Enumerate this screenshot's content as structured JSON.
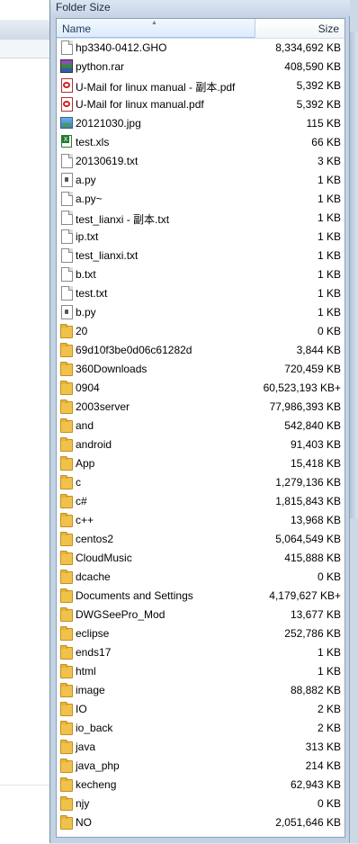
{
  "window": {
    "title": "Folder Size"
  },
  "columns": {
    "name": "Name",
    "size": "Size"
  },
  "items": [
    {
      "icon": "file-icon",
      "name": "hp3340-0412.GHO",
      "size": "8,334,692 KB"
    },
    {
      "icon": "rar-archive-icon",
      "name": "python.rar",
      "size": "408,590 KB"
    },
    {
      "icon": "pdf-icon",
      "name": "U-Mail for linux manual - 副本.pdf",
      "size": "5,392 KB"
    },
    {
      "icon": "pdf-icon",
      "name": "U-Mail for linux manual.pdf",
      "size": "5,392 KB"
    },
    {
      "icon": "image-icon",
      "name": "20121030.jpg",
      "size": "115 KB"
    },
    {
      "icon": "excel-icon",
      "name": "test.xls",
      "size": "66 KB"
    },
    {
      "icon": "file-icon",
      "name": "20130619.txt",
      "size": "3 KB"
    },
    {
      "icon": "python-file-icon",
      "name": "a.py",
      "size": "1 KB"
    },
    {
      "icon": "file-icon",
      "name": "a.py~",
      "size": "1 KB"
    },
    {
      "icon": "file-icon",
      "name": "test_lianxi - 副本.txt",
      "size": "1 KB"
    },
    {
      "icon": "file-icon",
      "name": "ip.txt",
      "size": "1 KB"
    },
    {
      "icon": "file-icon",
      "name": "test_lianxi.txt",
      "size": "1 KB"
    },
    {
      "icon": "file-icon",
      "name": "b.txt",
      "size": "1 KB"
    },
    {
      "icon": "file-icon",
      "name": "test.txt",
      "size": "1 KB"
    },
    {
      "icon": "python-file-icon",
      "name": "b.py",
      "size": "1 KB"
    },
    {
      "icon": "folder-icon",
      "name": "20",
      "size": "0 KB"
    },
    {
      "icon": "folder-icon",
      "name": "69d10f3be0d06c61282d",
      "size": "3,844 KB"
    },
    {
      "icon": "folder-icon",
      "name": "360Downloads",
      "size": "720,459 KB"
    },
    {
      "icon": "folder-icon",
      "name": "0904",
      "size": "60,523,193 KB+"
    },
    {
      "icon": "folder-icon",
      "name": "2003server",
      "size": "77,986,393 KB"
    },
    {
      "icon": "folder-icon",
      "name": "and",
      "size": "542,840 KB"
    },
    {
      "icon": "folder-icon",
      "name": "android",
      "size": "91,403 KB"
    },
    {
      "icon": "folder-icon",
      "name": "App",
      "size": "15,418 KB"
    },
    {
      "icon": "folder-icon",
      "name": "c",
      "size": "1,279,136 KB"
    },
    {
      "icon": "folder-icon",
      "name": "c#",
      "size": "1,815,843 KB"
    },
    {
      "icon": "folder-icon",
      "name": "c++",
      "size": "13,968 KB"
    },
    {
      "icon": "folder-icon",
      "name": "centos2",
      "size": "5,064,549 KB"
    },
    {
      "icon": "folder-icon",
      "name": "CloudMusic",
      "size": "415,888 KB"
    },
    {
      "icon": "folder-icon",
      "name": "dcache",
      "size": "0 KB"
    },
    {
      "icon": "folder-icon",
      "name": "Documents and Settings",
      "size": "4,179,627 KB+"
    },
    {
      "icon": "folder-icon",
      "name": "DWGSeePro_Mod",
      "size": "13,677 KB"
    },
    {
      "icon": "folder-icon",
      "name": "eclipse",
      "size": "252,786 KB"
    },
    {
      "icon": "folder-icon",
      "name": "ends17",
      "size": "1 KB"
    },
    {
      "icon": "folder-icon",
      "name": "html",
      "size": "1 KB"
    },
    {
      "icon": "folder-icon",
      "name": "image",
      "size": "88,882 KB"
    },
    {
      "icon": "folder-icon",
      "name": "IO",
      "size": "2 KB"
    },
    {
      "icon": "folder-icon",
      "name": "io_back",
      "size": "2 KB"
    },
    {
      "icon": "folder-icon",
      "name": "java",
      "size": "313 KB"
    },
    {
      "icon": "folder-icon",
      "name": "java_php",
      "size": "214 KB"
    },
    {
      "icon": "folder-icon",
      "name": "kecheng",
      "size": "62,943 KB"
    },
    {
      "icon": "folder-icon",
      "name": "njy",
      "size": "0 KB"
    },
    {
      "icon": "folder-icon",
      "name": "NO",
      "size": "2,051,646 KB"
    }
  ]
}
